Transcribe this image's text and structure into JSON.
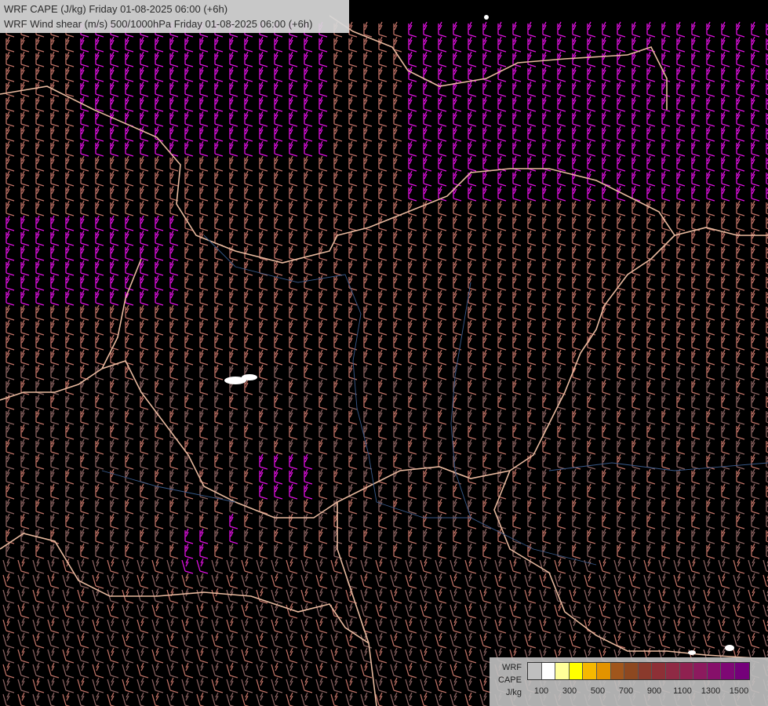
{
  "title": {
    "line1": "WRF CAPE (J/kg) Friday 01-08-2025 06:00 (+6h)",
    "line2": "WRF Wind shear (m/s) 500/1000hPa Friday 01-08-2025 06:00 (+6h)"
  },
  "legend": {
    "label_model": "WRF",
    "label_var": "CAPE",
    "label_unit": "J/kg",
    "swatch_colors": [
      "#bfbfbf",
      "#ffffff",
      "#ffff99",
      "#ffff00",
      "#f5b800",
      "#e39300",
      "#a0561c",
      "#8d4820",
      "#8a3a2c",
      "#8d3036",
      "#8f2a44",
      "#8f2150",
      "#8c1a5e",
      "#86106a",
      "#7e0874",
      "#74007a"
    ],
    "ticks": [
      "100",
      "300",
      "500",
      "700",
      "900",
      "1100",
      "1300",
      "1500"
    ]
  },
  "map": {
    "colors": {
      "background": "#000000",
      "barb_low": "#8b6260",
      "barb_mid": "#c07266",
      "barb_high": "#e88870",
      "barb_extreme": "#e010e0",
      "border": "#e8b99e",
      "river": "#3a5a8a",
      "terrain": "#5a5a5a"
    }
  }
}
